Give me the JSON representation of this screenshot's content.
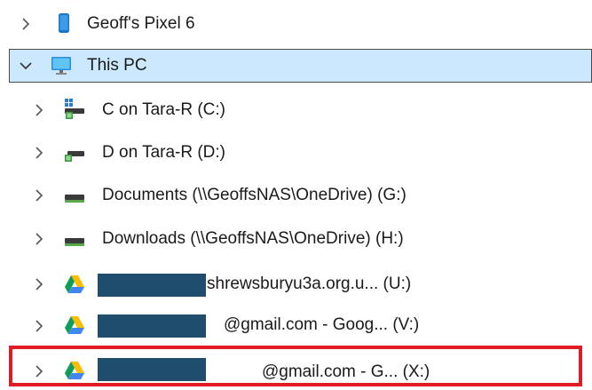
{
  "tree": {
    "items": [
      {
        "label": "Geoff's Pixel 6",
        "expanded": false,
        "icon": "phone-icon"
      },
      {
        "label": "This PC",
        "expanded": true,
        "selected": true,
        "icon": "monitor-icon"
      },
      {
        "label": "C on Tara-R (C:)",
        "expanded": false,
        "icon": "network-drive-icon"
      },
      {
        "label": "D on Tara-R (D:)",
        "expanded": false,
        "icon": "network-drive-icon"
      },
      {
        "label": "Documents (\\\\GeoffsNAS\\OneDrive) (G:)",
        "expanded": false,
        "icon": "drive-icon"
      },
      {
        "label": "Downloads (\\\\GeoffsNAS\\OneDrive) (H:)",
        "expanded": false,
        "icon": "drive-icon"
      },
      {
        "label": "shrewsburyu3a.org.u... (U:)",
        "expanded": false,
        "icon": "google-drive-icon",
        "redacted": true
      },
      {
        "label": "@gmail.com - Goog... (V:)",
        "expanded": false,
        "icon": "google-drive-icon",
        "redacted": true
      },
      {
        "label": "@gmail.com - G... (X:)",
        "expanded": false,
        "icon": "google-drive-icon",
        "redacted": true,
        "highlighted": true
      }
    ]
  },
  "colors": {
    "selection": "#cce8ff",
    "highlight": "#e01b24",
    "redaction": "#1e4d6e"
  }
}
